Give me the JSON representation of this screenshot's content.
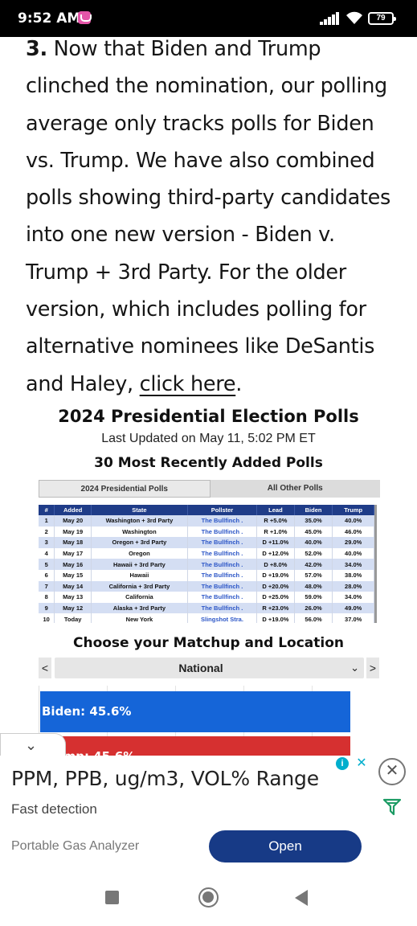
{
  "status_bar": {
    "time": "9:52 AM",
    "battery": "79"
  },
  "article": {
    "number": "3.",
    "text": " Now that Biden and Trump clinched the nomination, our polling average only tracks polls for Biden vs. Trump. We have also combined polls showing third-party candidates into one new version - Biden v. Trump + 3rd Party. For the older version, which includes polling for alternative nominees like DeSantis and Haley, ",
    "link": "click here",
    "end": "."
  },
  "widget": {
    "title": "2024 Presidential Election Polls",
    "updated": "Last Updated on May 11, 5:02 PM ET",
    "subtitle": "30 Most Recently Added Polls",
    "tabs": [
      "2024 Presidential Polls",
      "All Other Polls"
    ],
    "table": {
      "headers": [
        "#",
        "Added",
        "State",
        "Pollster",
        "Lead",
        "Biden",
        "Trump"
      ],
      "rows": [
        [
          "1",
          "May 20",
          "Washington + 3rd Party",
          "The Bullfinch .",
          "R +5.0%",
          "35.0%",
          "40.0%"
        ],
        [
          "2",
          "May 19",
          "Washington",
          "The Bullfinch .",
          "R +1.0%",
          "45.0%",
          "46.0%"
        ],
        [
          "3",
          "May 18",
          "Oregon + 3rd Party",
          "The Bullfinch .",
          "D +11.0%",
          "40.0%",
          "29.0%"
        ],
        [
          "4",
          "May 17",
          "Oregon",
          "The Bullfinch .",
          "D +12.0%",
          "52.0%",
          "40.0%"
        ],
        [
          "5",
          "May 16",
          "Hawaii + 3rd Party",
          "The Bullfinch .",
          "D +8.0%",
          "42.0%",
          "34.0%"
        ],
        [
          "6",
          "May 15",
          "Hawaii",
          "The Bullfinch .",
          "D +19.0%",
          "57.0%",
          "38.0%"
        ],
        [
          "7",
          "May 14",
          "California + 3rd Party",
          "The Bullfinch .",
          "D +20.0%",
          "48.0%",
          "28.0%"
        ],
        [
          "8",
          "May 13",
          "California",
          "The Bullfinch .",
          "D +25.0%",
          "59.0%",
          "34.0%"
        ],
        [
          "9",
          "May 12",
          "Alaska + 3rd Party",
          "The Bullfinch .",
          "R +23.0%",
          "26.0%",
          "49.0%"
        ],
        [
          "10",
          "Today",
          "New York",
          "Slingshot Stra.",
          "D +19.0%",
          "56.0%",
          "37.0%"
        ]
      ]
    },
    "matchup_title": "Choose your Matchup and Location",
    "select": {
      "prev": "<",
      "value": "National",
      "chevron": "⌄",
      "next": ">"
    },
    "bars": [
      {
        "label": "Biden: 45.6%",
        "value": 45.6,
        "color": "#1565d8"
      },
      {
        "label": "Trump: 45.6%",
        "value": 45.6,
        "color": "#d63030"
      }
    ]
  },
  "ad": {
    "headline": "PPM, PPB, ug/m3, VOL% Range",
    "sub": "Fast detection",
    "brand": "Portable Gas Analyzer",
    "cta": "Open",
    "info": "i",
    "x": "✕",
    "close": "✕",
    "collapse": "⌄"
  }
}
